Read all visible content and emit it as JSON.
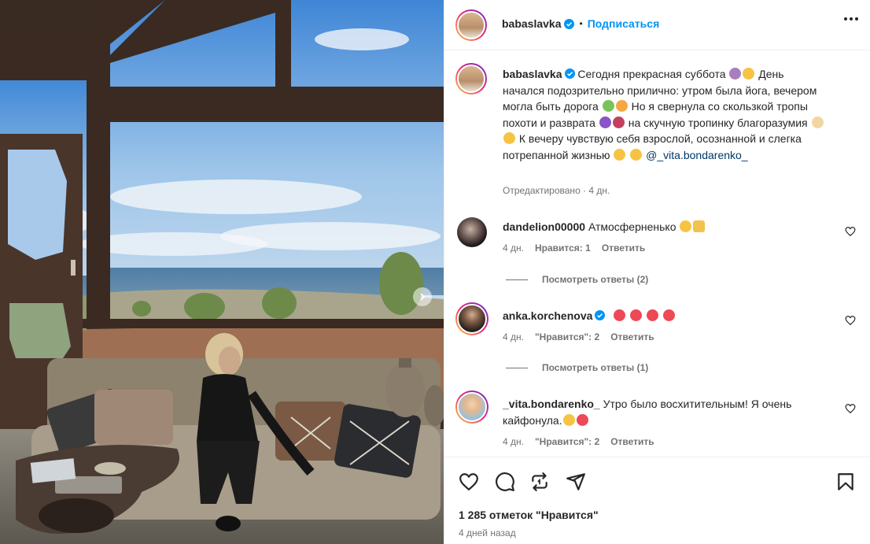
{
  "post": {
    "author": "babaslavka",
    "follow_label": "Подписаться",
    "dot": "•",
    "caption_text": "Сегодня прекрасная суббота 🧘 🥴 День начался подозрительно прилично: утром была йога, вечером могла быть дорога 🧪 😼 Но я свернула со скользкой тропы похоти и разврата 😈 🍷 на скучную тропинку благоразумия 🕯 😇 К вечеру чувствую себя взрослой, осознанной и слегка потрепанной жизнью 🤫 😂",
    "caption_lines": [
      "Сегодня прекрасная суббота",
      "День",
      "начался подозрительно прилично: утром была йога,",
      "вечером могла быть дорога",
      "Но я свернула со",
      "скользкой тропы похоти и разврата",
      "на скучную",
      "тропинку благоразумия",
      "К вечеру чувствую себя",
      "взрослой, осознанной и слегка потрепанной жизнью"
    ],
    "mention": "@_vita.bondarenko_",
    "caption_meta": "Отредактировано · 4 дн."
  },
  "comments": [
    {
      "user": "dandelion00000",
      "verified": false,
      "text": "Атмосферненько",
      "age": "4 дн.",
      "likes_label": "Нравится: 1",
      "reply_label": "Ответить",
      "view_replies": "Посмотреть ответы (2)"
    },
    {
      "user": "anka.korchenova",
      "verified": true,
      "text": "",
      "age": "4 дн.",
      "likes_label": "\"Нравится\": 2",
      "reply_label": "Ответить",
      "view_replies": "Посмотреть ответы (1)"
    },
    {
      "user": "_vita.bondarenko_",
      "verified": false,
      "text_line1": "Утро было восхитительным! Я очень",
      "text_line2": "кайфонула.",
      "age": "4 дн.",
      "likes_label": "\"Нравится\": 2",
      "reply_label": "Ответить"
    }
  ],
  "footer": {
    "likes": "1 285 отметок \"Нравится\"",
    "time_ago": "4 дней назад"
  },
  "icons": {
    "like": "heart-icon",
    "comment": "comment-icon",
    "repost": "repost-icon",
    "share": "send-icon",
    "save": "bookmark-icon",
    "more": "more-icon",
    "verified": "verified-badge-icon",
    "carousel": "chevron-right-icon"
  },
  "colors": {
    "accent": "#0095f6",
    "text": "#262626",
    "secondary": "#737373",
    "heart_emoji": "#ed4956"
  }
}
